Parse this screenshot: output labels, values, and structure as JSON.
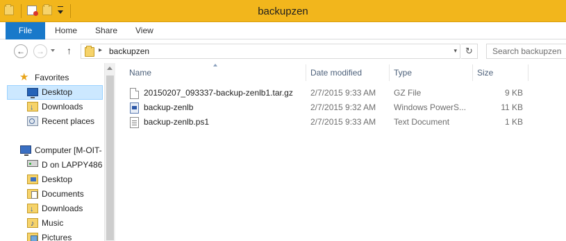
{
  "window": {
    "title": "backupzen"
  },
  "ribbon": {
    "tabs": [
      "File",
      "Home",
      "Share",
      "View"
    ]
  },
  "address": {
    "path": "backupzen",
    "search_placeholder": "Search backupzen"
  },
  "navpane": {
    "items": [
      {
        "label": "Favorites",
        "icon": "star-icon"
      },
      {
        "label": "Desktop",
        "icon": "desktop-icon",
        "selected": true
      },
      {
        "label": "Downloads",
        "icon": "downloads-icon"
      },
      {
        "label": "Recent places",
        "icon": "recent-places-icon"
      },
      {
        "label": "Computer [M-OIT-",
        "icon": "computer-icon"
      },
      {
        "label": "D on LAPPY486",
        "icon": "network-drive-icon"
      },
      {
        "label": "Desktop",
        "icon": "desktop-folder-icon"
      },
      {
        "label": "Documents",
        "icon": "documents-icon"
      },
      {
        "label": "Downloads",
        "icon": "downloads-icon"
      },
      {
        "label": "Music",
        "icon": "music-icon"
      },
      {
        "label": "Pictures",
        "icon": "pictures-icon"
      }
    ]
  },
  "filelist": {
    "columns": [
      "Name",
      "Date modified",
      "Type",
      "Size"
    ],
    "rows": [
      {
        "name": "20150207_093337-backup-zenlb1.tar.gz",
        "date": "2/7/2015 9:33 AM",
        "type": "GZ File",
        "size": "9 KB",
        "icon": "gz-file-icon"
      },
      {
        "name": "backup-zenlb",
        "date": "2/7/2015 9:32 AM",
        "type": "Windows PowerS...",
        "size": "11 KB",
        "icon": "powershell-file-icon"
      },
      {
        "name": "backup-zenlb.ps1",
        "date": "2/7/2015 9:33 AM",
        "type": "Text Document",
        "size": "1 KB",
        "icon": "text-file-icon"
      }
    ]
  }
}
